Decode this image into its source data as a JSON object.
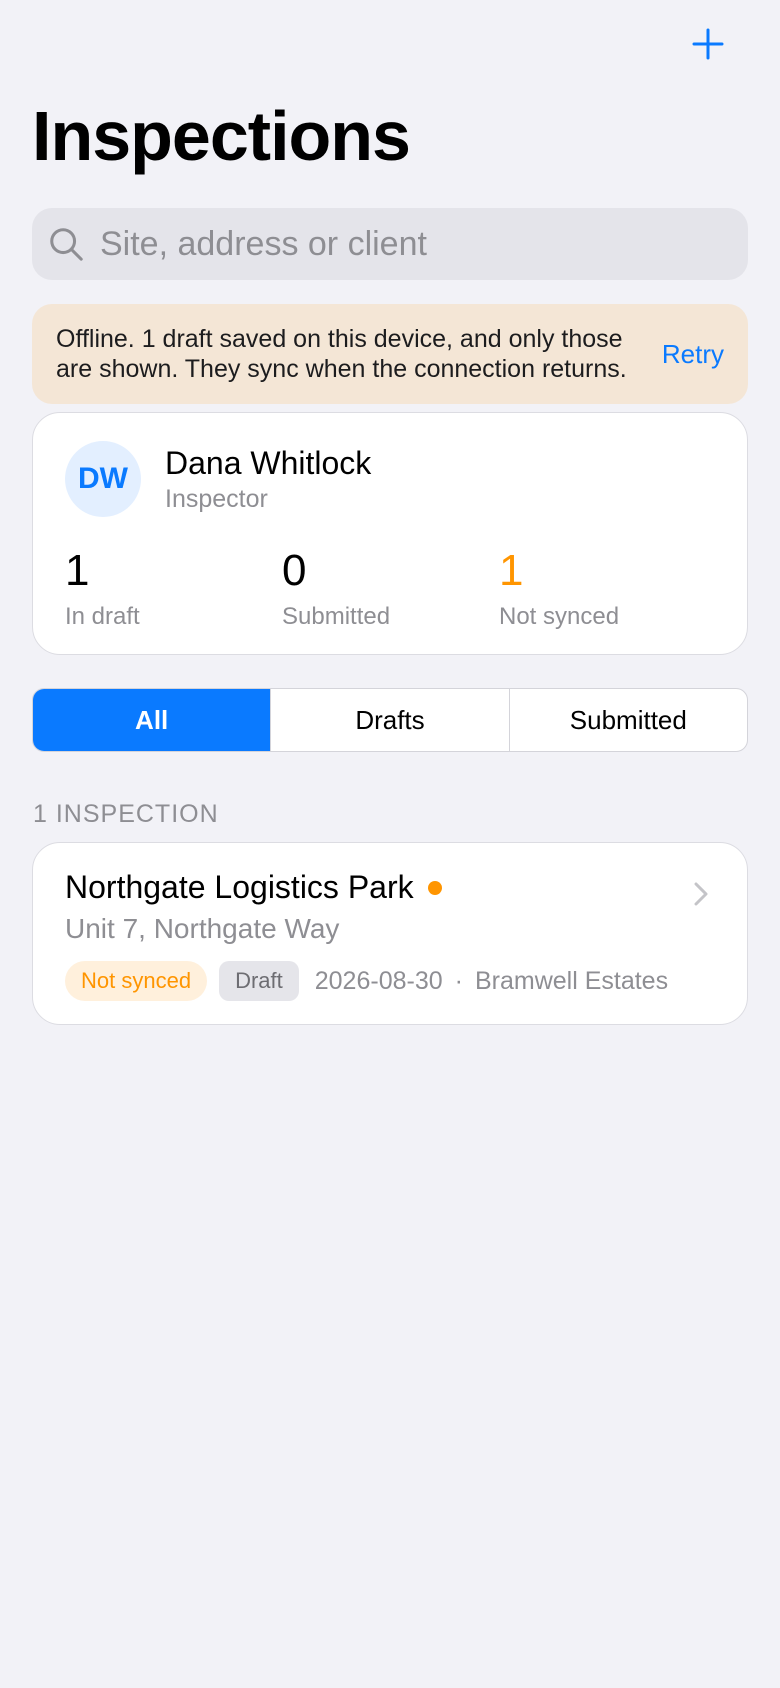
{
  "header": {
    "title": "Inspections",
    "add_icon": "plus-icon"
  },
  "search": {
    "placeholder": "Site, address or client",
    "value": ""
  },
  "banner": {
    "text": "Offline. 1 draft saved on this device, and only those are shown. They sync when the connection returns.",
    "action": "Retry"
  },
  "profile": {
    "initials": "DW",
    "name": "Dana Whitlock",
    "role": "Inspector",
    "stats": [
      {
        "value": "1",
        "label": "In draft"
      },
      {
        "value": "0",
        "label": "Submitted"
      },
      {
        "value": "1",
        "label": "Not synced"
      }
    ]
  },
  "segments": {
    "items": [
      "All",
      "Drafts",
      "Submitted"
    ],
    "selected": "All"
  },
  "list": {
    "header": "1 INSPECTION",
    "items": [
      {
        "title": "Northgate Logistics Park",
        "subtitle": "Unit 7, Northgate Way",
        "sync_badge": "Not synced",
        "status_badge": "Draft",
        "date": "2026-08-30",
        "separator": "·",
        "client": "Bramwell Estates"
      }
    ]
  },
  "colors": {
    "accent": "#0a7aff",
    "warning": "#ff9500",
    "background": "#f2f2f7",
    "banner": "#f4e6d6"
  }
}
